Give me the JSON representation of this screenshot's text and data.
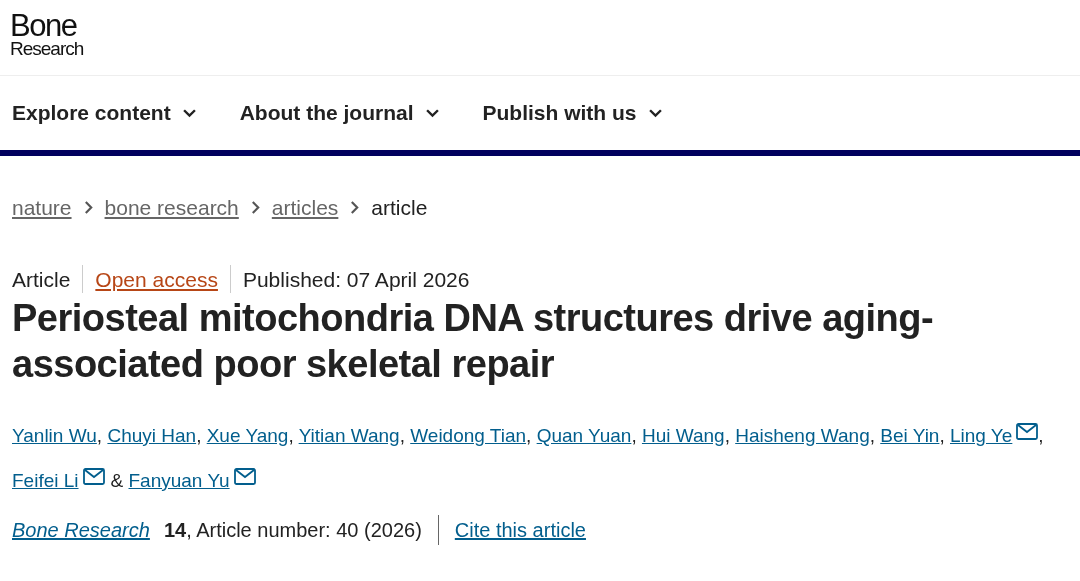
{
  "logo": {
    "line_1": "Bone",
    "line_2": "Research"
  },
  "nav": [
    {
      "label": "Explore content"
    },
    {
      "label": "About the journal"
    },
    {
      "label": "Publish with us"
    }
  ],
  "breadcrumbs": [
    {
      "label": "nature",
      "link": true
    },
    {
      "label": "bone research",
      "link": true
    },
    {
      "label": "articles",
      "link": true
    },
    {
      "label": "article",
      "link": false
    }
  ],
  "meta": {
    "type": "Article",
    "access": "Open access",
    "published": "Published: 07 April 2026"
  },
  "title": "Periosteal mitochondria DNA structures drive aging-associated poor skeletal repair",
  "authors": [
    {
      "name": "Yanlin Wu",
      "email": false,
      "after": ","
    },
    {
      "name": "Chuyi Han",
      "email": false,
      "after": ","
    },
    {
      "name": "Xue Yang",
      "email": false,
      "after": ","
    },
    {
      "name": "Yitian Wang",
      "email": false,
      "after": ","
    },
    {
      "name": "Weidong Tian",
      "email": false,
      "after": ","
    },
    {
      "name": "Quan Yuan",
      "email": false,
      "after": ","
    },
    {
      "name": "Hui Wang",
      "email": false,
      "after": ","
    },
    {
      "name": "Haisheng Wang",
      "email": false,
      "after": ","
    },
    {
      "name": "Bei Yin",
      "email": false,
      "after": ","
    },
    {
      "name": "Ling Ye",
      "email": true,
      "after": ","
    },
    {
      "name": "Feifei Li",
      "email": true,
      "after": "&"
    },
    {
      "name": "Fanyuan Yu",
      "email": true
    }
  ],
  "citation": {
    "journal": "Bone Research",
    "volume": "14",
    "rest": ", Article number: 40 (2026)",
    "cite": "Cite this article"
  }
}
